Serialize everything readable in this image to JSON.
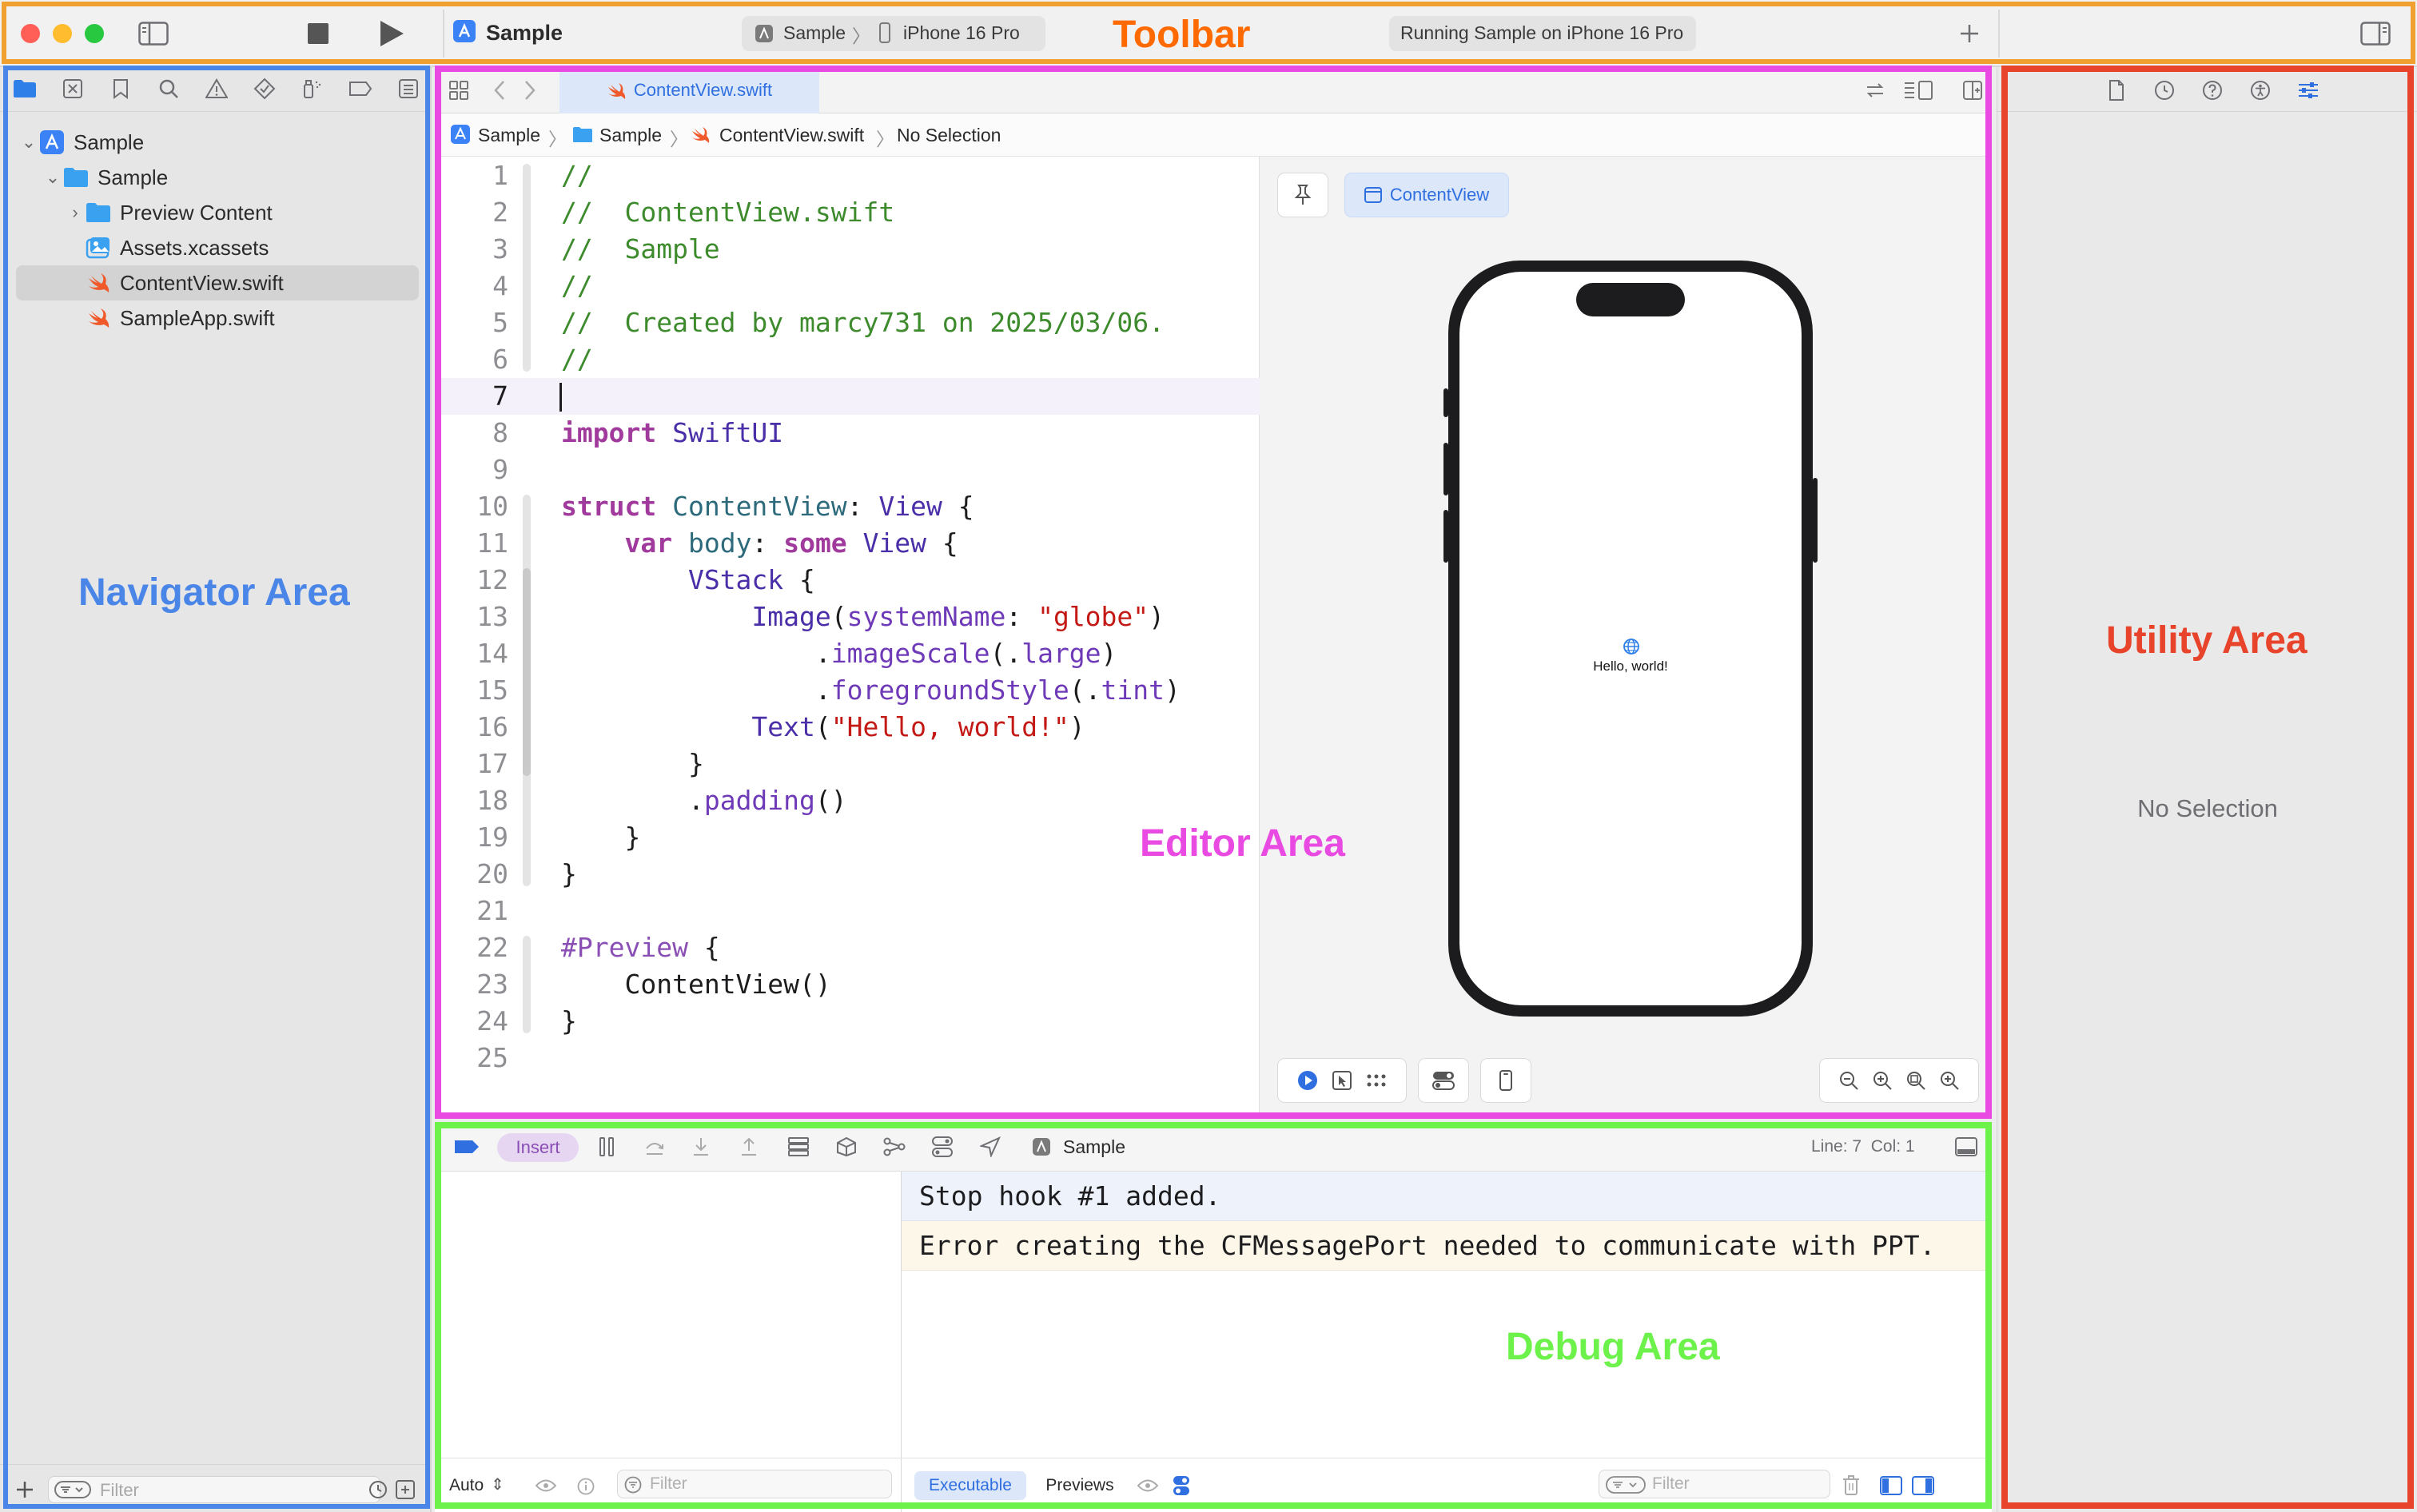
{
  "colors": {
    "toolbar_frame": "#f0a030",
    "navigator_frame": "#4a86e8",
    "editor_frame": "#e94ae2",
    "debug_frame": "#6cf24a",
    "utility_frame": "#e8442c",
    "accent": "#2f6fe0",
    "swift_orange": "#f0592a"
  },
  "annotations": {
    "toolbar": "Toolbar",
    "navigator": "Navigator Area",
    "editor": "Editor Area",
    "debug": "Debug Area",
    "utility": "Utility Area"
  },
  "toolbar": {
    "project_title": "Sample",
    "scheme": "Sample",
    "device": "iPhone 16 Pro",
    "status": "Running Sample on iPhone 16 Pro",
    "add_icon": "plus-icon",
    "sidebar_icon": "sidebar-left-icon",
    "stop_icon": "stop-icon",
    "run_icon": "play-icon"
  },
  "navigator": {
    "tree": [
      {
        "label": "Sample",
        "icon": "project-icon",
        "level": 0,
        "expanded": true
      },
      {
        "label": "Sample",
        "icon": "folder-icon",
        "level": 1,
        "expanded": true
      },
      {
        "label": "Preview Content",
        "icon": "folder-icon",
        "level": 2,
        "expanded": false
      },
      {
        "label": "Assets.xcassets",
        "icon": "assets-icon",
        "level": 2
      },
      {
        "label": "ContentView.swift",
        "icon": "swift-icon",
        "level": 2,
        "selected": true
      },
      {
        "label": "SampleApp.swift",
        "icon": "swift-icon",
        "level": 2
      }
    ],
    "filter_placeholder": "Filter"
  },
  "editor": {
    "tab_label": "ContentView.swift",
    "breadcrumb": [
      "Sample",
      "Sample",
      "ContentView.swift",
      "No Selection"
    ],
    "current_line": 7,
    "code": [
      "//",
      "//  ContentView.swift",
      "//  Sample",
      "//",
      "//  Created by marcy731 on 2025/03/06.",
      "//",
      "",
      "import SwiftUI",
      "",
      "struct ContentView: View {",
      "    var body: some View {",
      "        VStack {",
      "            Image(systemName: \"globe\")",
      "                .imageScale(.large)",
      "                .foregroundStyle(.tint)",
      "            Text(\"Hello, world!\")",
      "        }",
      "        .padding()",
      "    }",
      "}",
      "",
      "#Preview {",
      "    ContentView()",
      "}",
      ""
    ],
    "line_numbers": [
      "1",
      "2",
      "3",
      "4",
      "5",
      "6",
      "7",
      "8",
      "9",
      "10",
      "11",
      "12",
      "13",
      "14",
      "15",
      "16",
      "17",
      "18",
      "19",
      "20",
      "21",
      "22",
      "23",
      "24",
      "25"
    ],
    "preview": {
      "selector_label": "ContentView",
      "hello_text": "Hello, world!"
    }
  },
  "debug": {
    "mode_pill": "Insert",
    "target": "Sample",
    "position": "Line: 7  Col: 1",
    "variables_scope": "Auto",
    "left_filter_placeholder": "Filter",
    "console_lines": [
      "Stop hook #1 added.",
      "Error creating the CFMessagePort needed to communicate with PPT."
    ],
    "tab_executable": "Executable",
    "tab_previews": "Previews",
    "console_filter_placeholder": "Filter"
  },
  "utility": {
    "empty_text": "No Selection"
  }
}
